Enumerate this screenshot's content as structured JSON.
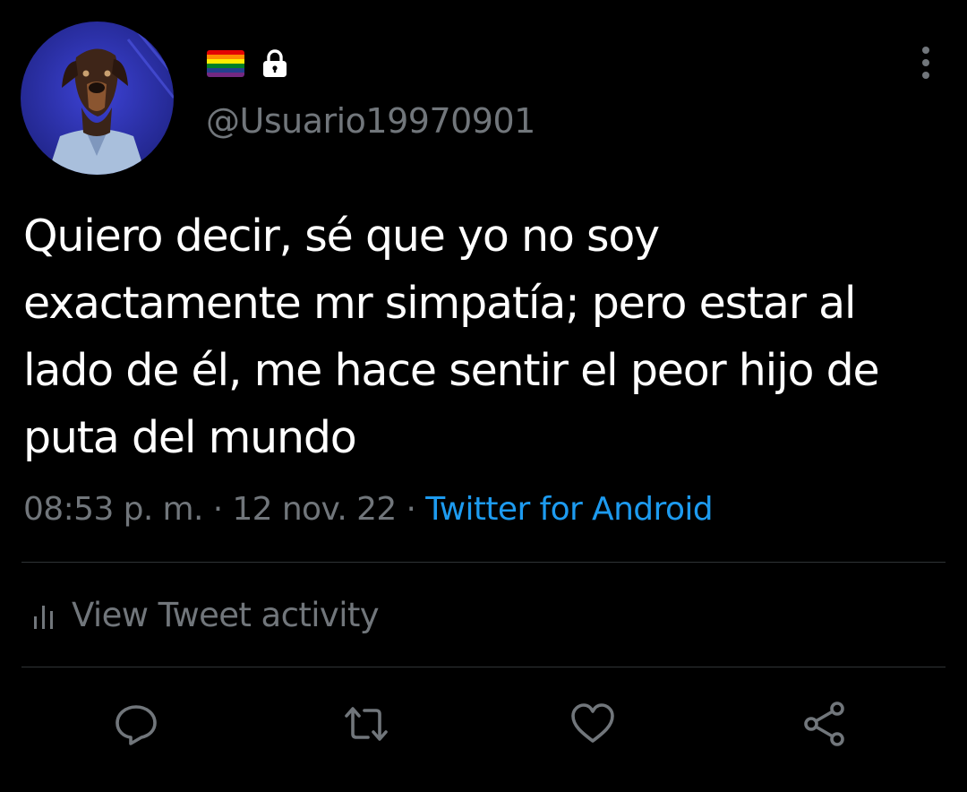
{
  "profile": {
    "handle": "@Usuario19970901",
    "avatar": "avatar-dog-photo",
    "badges": [
      "rainbow-flag-icon",
      "lock-icon"
    ]
  },
  "tweet": {
    "text_lines": [
      "Quiero decir, sé que yo no soy",
      "exactamente mr simpatía; pero estar al",
      "lado de él, me hace sentir el peor hijo de",
      "puta del mundo"
    ],
    "time": "08:53 p. m.",
    "date": "12 nov. 22",
    "separator": "·",
    "source": "Twitter for Android"
  },
  "activity": {
    "label": "View Tweet activity",
    "icon": "stats-icon"
  },
  "actions": {
    "icons": [
      "reply-icon",
      "retweet-icon",
      "like-icon",
      "share-icon"
    ]
  },
  "more_menu_icon": "more-vertical-icon",
  "colors": {
    "background": "#000000",
    "text": "#ffffff",
    "secondary": "#71767b",
    "link": "#1d9bf0",
    "divider": "#2f3336",
    "avatar_bg": "#2b2fa8"
  }
}
